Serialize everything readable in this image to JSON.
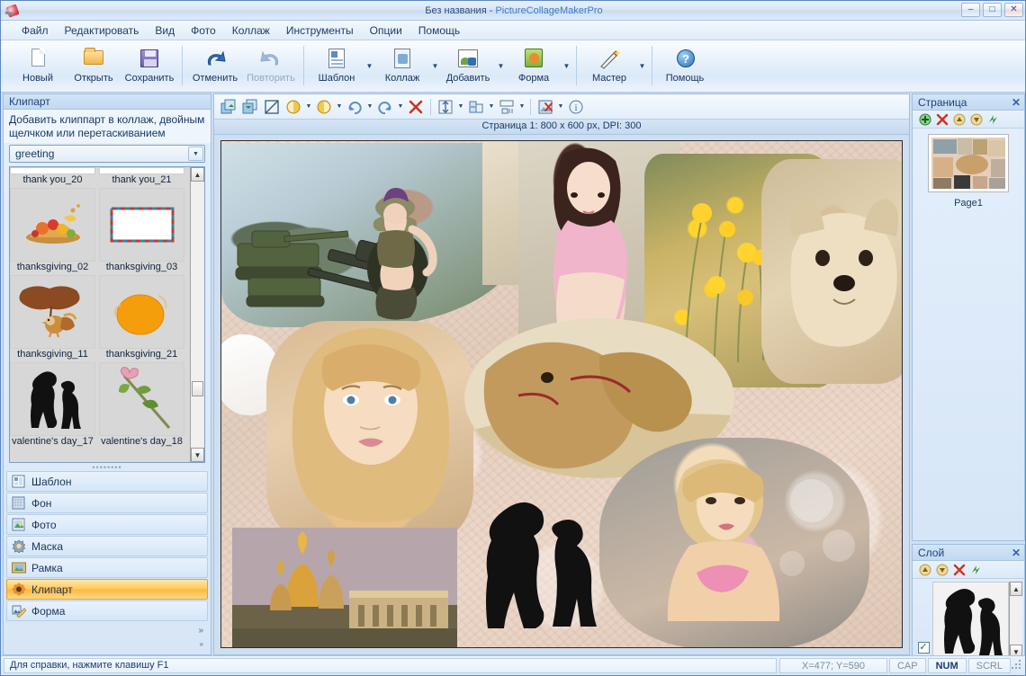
{
  "window": {
    "title_doc": "Без названия",
    "title_sep": " - ",
    "title_app": "PictureCollageMakerPro",
    "minimize": "–",
    "maximize": "□",
    "close": "✕"
  },
  "menu": [
    {
      "label": "Файл"
    },
    {
      "label": "Редактировать"
    },
    {
      "label": "Вид"
    },
    {
      "label": "Фото"
    },
    {
      "label": "Коллаж"
    },
    {
      "label": "Инструменты"
    },
    {
      "label": "Опции"
    },
    {
      "label": "Помощь"
    }
  ],
  "toolbar": [
    {
      "label": "Новый",
      "icon": "new-document-icon",
      "disabled": false,
      "dropdown": false
    },
    {
      "label": "Открыть",
      "icon": "open-folder-icon",
      "disabled": false,
      "dropdown": false
    },
    {
      "label": "Сохранить",
      "icon": "save-floppy-icon",
      "disabled": false,
      "dropdown": false
    },
    {
      "label": "Отменить",
      "icon": "undo-arrow-icon",
      "disabled": false,
      "dropdown": false
    },
    {
      "label": "Повторить",
      "icon": "redo-arrow-icon",
      "disabled": true,
      "dropdown": false
    },
    {
      "label": "Шаблон",
      "icon": "template-icon",
      "disabled": false,
      "dropdown": true
    },
    {
      "label": "Коллаж",
      "icon": "collage-icon",
      "disabled": false,
      "dropdown": true
    },
    {
      "label": "Добавить",
      "icon": "add-photo-icon",
      "disabled": false,
      "dropdown": true
    },
    {
      "label": "Форма",
      "icon": "shape-icon",
      "disabled": false,
      "dropdown": true
    },
    {
      "label": "Мастер",
      "icon": "wizard-wand-icon",
      "disabled": false,
      "dropdown": true
    },
    {
      "label": "Помощь",
      "icon": "help-question-icon",
      "disabled": false,
      "dropdown": false
    }
  ],
  "subtoolbar": [
    {
      "name": "bring-to-front-icon",
      "glyph": "◲"
    },
    {
      "name": "send-to-back-icon",
      "glyph": "◳"
    },
    {
      "name": "crop-icon",
      "glyph": "⊠"
    },
    {
      "name": "rotate-left-step-icon",
      "glyph": "◐",
      "dropdown": true
    },
    {
      "name": "rotate-right-step-icon",
      "glyph": "◑",
      "dropdown": true
    },
    {
      "name": "rotate-cw-icon",
      "glyph": "↻",
      "dropdown": true
    },
    {
      "name": "rotate-ccw-icon",
      "glyph": "↺",
      "dropdown": true
    },
    {
      "name": "delete-icon",
      "glyph": "✕"
    },
    {
      "name": "align-vertical-icon",
      "glyph": "⇳",
      "dropdown": true
    },
    {
      "name": "flip-icon",
      "glyph": "⇄",
      "dropdown": true
    },
    {
      "name": "distribute-icon",
      "glyph": "▤",
      "dropdown": true
    },
    {
      "name": "remove-background-icon",
      "glyph": "▣",
      "dropdown": true
    },
    {
      "name": "info-icon",
      "glyph": "ⓘ"
    }
  ],
  "clipart_panel": {
    "title": "Клипарт",
    "hint": "Добавить клиппарт в коллаж, двойным щелчком или перетаскиванием",
    "category_selected": "greeting",
    "items": [
      {
        "name": "thank you_20",
        "art": "cornucopia"
      },
      {
        "name": "thank you_21",
        "art": "envelope"
      },
      {
        "name": "thanksgiving_02",
        "art": "turkey"
      },
      {
        "name": "thanksgiving_03",
        "art": "pumpkin"
      },
      {
        "name": "thanksgiving_11",
        "art": "kissing-couple"
      },
      {
        "name": "thanksgiving_21",
        "art": "rose"
      },
      {
        "name": "valentine's day_17",
        "art": ""
      },
      {
        "name": "valentine's day_18",
        "art": ""
      }
    ],
    "nav": [
      {
        "label": "Шаблон",
        "icon": "template-icon",
        "selected": false
      },
      {
        "label": "Фон",
        "icon": "background-icon",
        "selected": false
      },
      {
        "label": "Фото",
        "icon": "photo-icon",
        "selected": false
      },
      {
        "label": "Маска",
        "icon": "mask-icon",
        "selected": false
      },
      {
        "label": "Рамка",
        "icon": "frame-icon",
        "selected": false
      },
      {
        "label": "Клипарт",
        "icon": "clipart-icon",
        "selected": true
      },
      {
        "label": "Форма",
        "icon": "shape-icon",
        "selected": false
      }
    ],
    "expand_chevron": "»"
  },
  "canvas": {
    "header": "Страница 1: 800 x 600 px, DPI: 300",
    "photos": [
      {
        "name": "soldier-tank-photo"
      },
      {
        "name": "interior-lamp-photo"
      },
      {
        "name": "girl-in-pink-photo"
      },
      {
        "name": "yellow-flowers-photo"
      },
      {
        "name": "terrier-dog-photo"
      },
      {
        "name": "blonde-woman-portrait-photo"
      },
      {
        "name": "camel-photo"
      },
      {
        "name": "church-cathedral-photo"
      },
      {
        "name": "blonde-bikini-photo"
      },
      {
        "name": "kissing-couple-clipart"
      }
    ]
  },
  "page_panel": {
    "title": "Страница",
    "close": "✕",
    "tools": [
      {
        "name": "add-page-button",
        "glyph": "✚"
      },
      {
        "name": "delete-page-button",
        "glyph": "✕"
      },
      {
        "name": "move-page-up-button",
        "glyph": "↑"
      },
      {
        "name": "move-page-down-button",
        "glyph": "↓"
      },
      {
        "name": "refresh-pages-button",
        "glyph": "↯"
      }
    ],
    "pages": [
      {
        "label": "Page1"
      }
    ]
  },
  "layer_panel": {
    "title": "Слой",
    "close": "✕",
    "tools": [
      {
        "name": "layer-up-button",
        "glyph": "↑"
      },
      {
        "name": "layer-down-button",
        "glyph": "↓"
      },
      {
        "name": "delete-layer-button",
        "glyph": "✕"
      },
      {
        "name": "refresh-layers-button",
        "glyph": "↯"
      }
    ],
    "layers": [
      {
        "label": "Clipart",
        "visible": true,
        "check": "✓"
      }
    ],
    "scroll_up": "⌃",
    "scroll_down": "⌄"
  },
  "statusbar": {
    "hint": "Для справки, нажмите клавишу F1",
    "coords": "X=477; Y=590",
    "cap": "CAP",
    "num": "NUM",
    "scrl": "SCRL"
  }
}
